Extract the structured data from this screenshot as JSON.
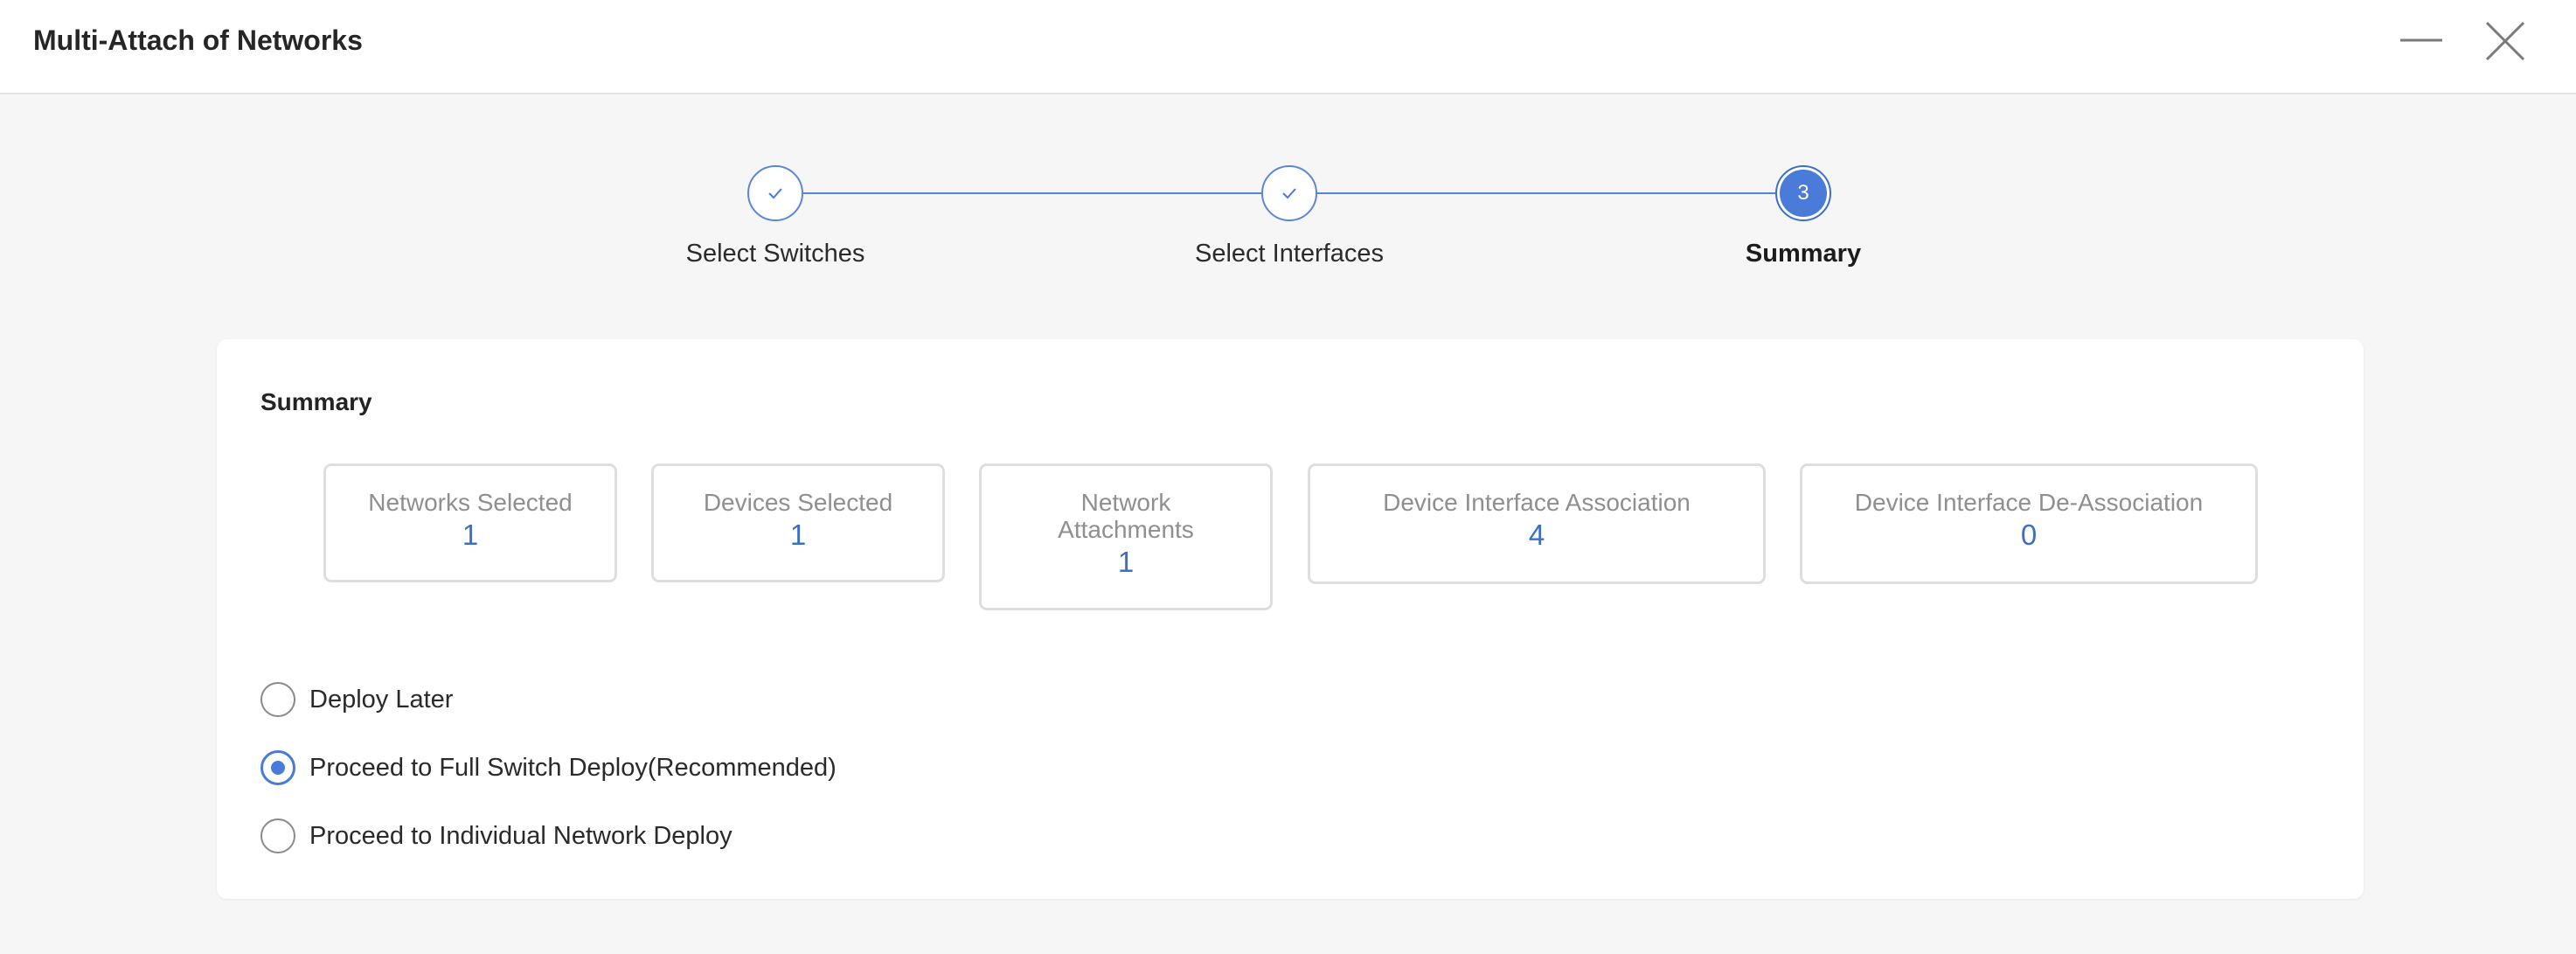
{
  "window": {
    "title": "Multi-Attach of Networks",
    "minimize_icon": "minimize-icon",
    "close_icon": "close-icon"
  },
  "stepper": {
    "steps": [
      {
        "label": "Select Switches",
        "state": "completed",
        "icon": "check-icon"
      },
      {
        "label": "Select Interfaces",
        "state": "completed",
        "icon": "check-icon"
      },
      {
        "label": "Summary",
        "state": "active",
        "number": "3"
      }
    ],
    "accent_color": "#4a7bd8"
  },
  "summary": {
    "title": "Summary",
    "stats": [
      {
        "label": "Networks Selected",
        "value": "1"
      },
      {
        "label": "Devices Selected",
        "value": "1"
      },
      {
        "label": "Network Attachments",
        "value": "1"
      },
      {
        "label": "Device Interface Association",
        "value": "4"
      },
      {
        "label": "Device Interface De-Association",
        "value": "0"
      }
    ],
    "deploy_options": [
      {
        "label": "Deploy Later",
        "selected": false
      },
      {
        "label": "Proceed to Full Switch Deploy(Recommended)",
        "selected": true
      },
      {
        "label": "Proceed to Individual Network Deploy",
        "selected": false
      }
    ]
  }
}
